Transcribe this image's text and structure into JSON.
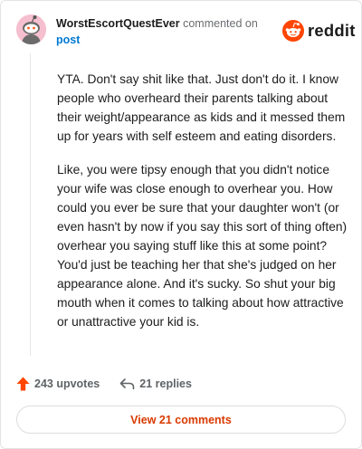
{
  "header": {
    "username": "WorstEscortQuestEver",
    "action_text": " commented on",
    "post_link": "post"
  },
  "brand": {
    "name": "reddit",
    "icon": "reddit-snoo-icon",
    "color": "#ff4500"
  },
  "comment": {
    "paragraphs": [
      "YTA. Don't say shit like that. Just don't do it. I know people who overheard their parents talking about their weight/appearance as kids and it messed them up for years with self esteem and eating disorders.",
      "Like, you were tipsy enough that you didn't notice your wife was close enough to overhear you. How could you ever be sure that your daughter won't (or even hasn't by now if you say this sort of thing often) overhear you saying stuff like this at some point? You'd just be teaching her that she's judged on her appearance alone. And it's sucky. So shut your big mouth when it comes to talking about how attractive or unattractive your kid is."
    ]
  },
  "actions": {
    "upvotes": "243 upvotes",
    "upvote_icon": "upvote-arrow-icon",
    "replies": "21 replies",
    "reply_icon": "reply-arrow-icon"
  },
  "view_comments_label": "View 21 comments",
  "colors": {
    "accent": "#d93a00",
    "upvote": "#ff4500",
    "link": "#0079d3"
  }
}
